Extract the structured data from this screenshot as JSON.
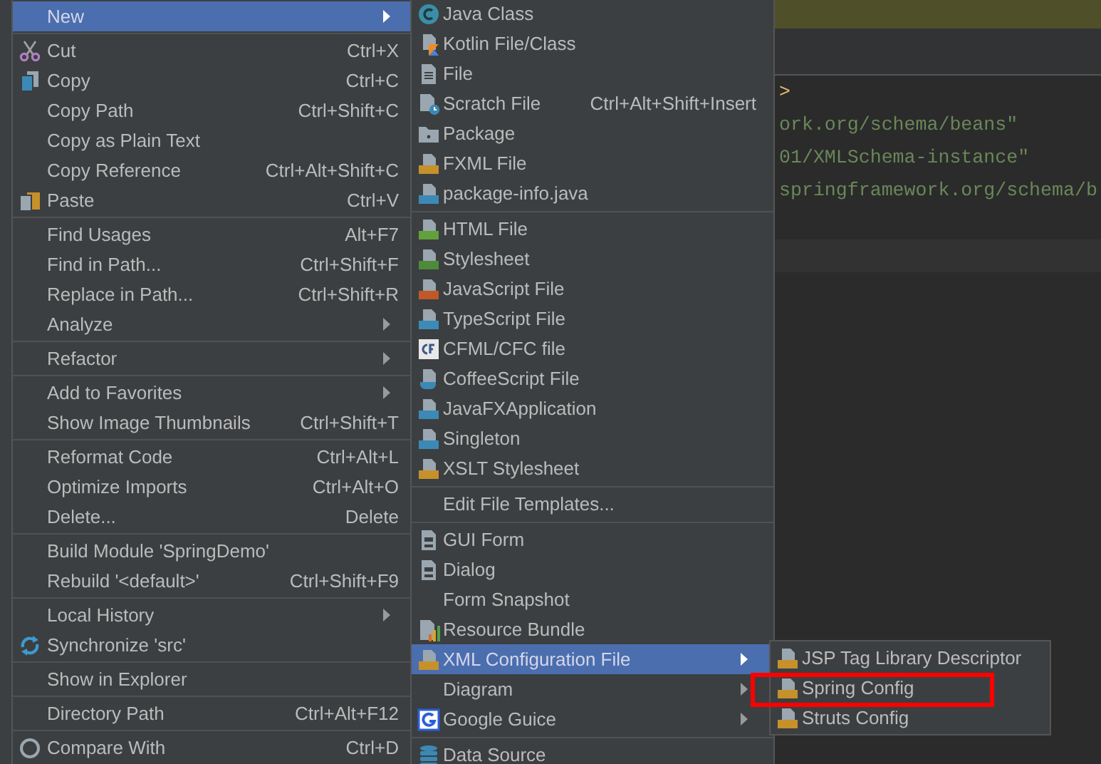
{
  "editor": {
    "code_lines": [
      {
        "kind": "tag",
        "text": ">"
      },
      {
        "kind": "string",
        "text": "ork.org/schema/beans\""
      },
      {
        "kind": "string",
        "text": "01/XMLSchema-instance\""
      },
      {
        "kind": "string",
        "text": "springframework.org/schema/b"
      }
    ]
  },
  "context_menu": {
    "items": [
      {
        "kind": "item",
        "label": "New",
        "selected": true,
        "submenu": true
      },
      {
        "kind": "separator"
      },
      {
        "kind": "item",
        "label": "Cut",
        "shortcut": "Ctrl+X",
        "selected": false,
        "submenu": false
      },
      {
        "kind": "item",
        "label": "Copy",
        "shortcut": "Ctrl+C",
        "selected": false,
        "submenu": false
      },
      {
        "kind": "item",
        "label": "Copy Path",
        "shortcut": "Ctrl+Shift+C",
        "selected": false,
        "submenu": false
      },
      {
        "kind": "item",
        "label": "Copy as Plain Text",
        "selected": false,
        "submenu": false
      },
      {
        "kind": "item",
        "label": "Copy Reference",
        "shortcut": "Ctrl+Alt+Shift+C",
        "selected": false,
        "submenu": false
      },
      {
        "kind": "item",
        "label": "Paste",
        "shortcut": "Ctrl+V",
        "selected": false,
        "submenu": false
      },
      {
        "kind": "separator"
      },
      {
        "kind": "item",
        "label": "Find Usages",
        "shortcut": "Alt+F7",
        "selected": false,
        "submenu": false
      },
      {
        "kind": "item",
        "label": "Find in Path...",
        "shortcut": "Ctrl+Shift+F",
        "selected": false,
        "submenu": false
      },
      {
        "kind": "item",
        "label": "Replace in Path...",
        "shortcut": "Ctrl+Shift+R",
        "selected": false,
        "submenu": false
      },
      {
        "kind": "item",
        "label": "Analyze",
        "selected": false,
        "submenu": true
      },
      {
        "kind": "separator"
      },
      {
        "kind": "item",
        "label": "Refactor",
        "selected": false,
        "submenu": true
      },
      {
        "kind": "separator"
      },
      {
        "kind": "item",
        "label": "Add to Favorites",
        "selected": false,
        "submenu": true
      },
      {
        "kind": "item",
        "label": "Show Image Thumbnails",
        "shortcut": "Ctrl+Shift+T",
        "selected": false,
        "submenu": false
      },
      {
        "kind": "separator"
      },
      {
        "kind": "item",
        "label": "Reformat Code",
        "shortcut": "Ctrl+Alt+L",
        "selected": false,
        "submenu": false
      },
      {
        "kind": "item",
        "label": "Optimize Imports",
        "shortcut": "Ctrl+Alt+O",
        "selected": false,
        "submenu": false
      },
      {
        "kind": "item",
        "label": "Delete...",
        "shortcut": "Delete",
        "selected": false,
        "submenu": false
      },
      {
        "kind": "separator"
      },
      {
        "kind": "item",
        "label": "Build Module 'SpringDemo'",
        "selected": false,
        "submenu": false
      },
      {
        "kind": "item",
        "label": "Rebuild '<default>'",
        "shortcut": "Ctrl+Shift+F9",
        "selected": false,
        "submenu": false
      },
      {
        "kind": "separator"
      },
      {
        "kind": "item",
        "label": "Local History",
        "selected": false,
        "submenu": true
      },
      {
        "kind": "item",
        "label": "Synchronize 'src'",
        "selected": false,
        "submenu": false
      },
      {
        "kind": "separator"
      },
      {
        "kind": "item",
        "label": "Show in Explorer",
        "selected": false,
        "submenu": false
      },
      {
        "kind": "separator"
      },
      {
        "kind": "item",
        "label": "Directory Path",
        "shortcut": "Ctrl+Alt+F12",
        "selected": false,
        "submenu": false
      },
      {
        "kind": "separator"
      },
      {
        "kind": "item",
        "label": "Compare With",
        "shortcut": "Ctrl+D",
        "selected": false,
        "submenu": false
      }
    ]
  },
  "new_submenu": {
    "items": [
      {
        "kind": "item",
        "label": "Java Class",
        "selected": false,
        "submenu": false
      },
      {
        "kind": "item",
        "label": "Kotlin File/Class",
        "selected": false,
        "submenu": false
      },
      {
        "kind": "item",
        "label": "File",
        "selected": false,
        "submenu": false
      },
      {
        "kind": "item",
        "label": "Scratch File",
        "shortcut": "Ctrl+Alt+Shift+Insert",
        "selected": false,
        "submenu": false
      },
      {
        "kind": "item",
        "label": "Package",
        "selected": false,
        "submenu": false
      },
      {
        "kind": "item",
        "label": "FXML File",
        "selected": false,
        "submenu": false
      },
      {
        "kind": "item",
        "label": "package-info.java",
        "selected": false,
        "submenu": false
      },
      {
        "kind": "separator"
      },
      {
        "kind": "item",
        "label": "HTML File",
        "selected": false,
        "submenu": false
      },
      {
        "kind": "item",
        "label": "Stylesheet",
        "selected": false,
        "submenu": false
      },
      {
        "kind": "item",
        "label": "JavaScript File",
        "selected": false,
        "submenu": false
      },
      {
        "kind": "item",
        "label": "TypeScript File",
        "selected": false,
        "submenu": false
      },
      {
        "kind": "item",
        "label": "CFML/CFC file",
        "selected": false,
        "submenu": false
      },
      {
        "kind": "item",
        "label": "CoffeeScript File",
        "selected": false,
        "submenu": false
      },
      {
        "kind": "item",
        "label": "JavaFXApplication",
        "selected": false,
        "submenu": false
      },
      {
        "kind": "item",
        "label": "Singleton",
        "selected": false,
        "submenu": false
      },
      {
        "kind": "item",
        "label": "XSLT Stylesheet",
        "selected": false,
        "submenu": false
      },
      {
        "kind": "separator"
      },
      {
        "kind": "item",
        "label": "Edit File Templates...",
        "selected": false,
        "submenu": false
      },
      {
        "kind": "separator"
      },
      {
        "kind": "item",
        "label": "GUI Form",
        "selected": false,
        "submenu": false
      },
      {
        "kind": "item",
        "label": "Dialog",
        "selected": false,
        "submenu": false
      },
      {
        "kind": "item",
        "label": "Form Snapshot",
        "selected": false,
        "submenu": false
      },
      {
        "kind": "item",
        "label": "Resource Bundle",
        "selected": false,
        "submenu": false
      },
      {
        "kind": "item",
        "label": "XML Configuration File",
        "selected": true,
        "submenu": true
      },
      {
        "kind": "item",
        "label": "Diagram",
        "selected": false,
        "submenu": true
      },
      {
        "kind": "item",
        "label": "Google Guice",
        "selected": false,
        "submenu": true
      },
      {
        "kind": "separator"
      },
      {
        "kind": "item",
        "label": "Data Source",
        "selected": false,
        "submenu": false
      }
    ]
  },
  "xml_submenu": {
    "items": [
      {
        "kind": "item",
        "label": "JSP Tag Library Descriptor",
        "selected": false,
        "submenu": false
      },
      {
        "kind": "item",
        "label": "Spring Config",
        "selected": false,
        "submenu": false
      },
      {
        "kind": "item",
        "label": "Struts Config",
        "selected": false,
        "submenu": false
      }
    ]
  }
}
